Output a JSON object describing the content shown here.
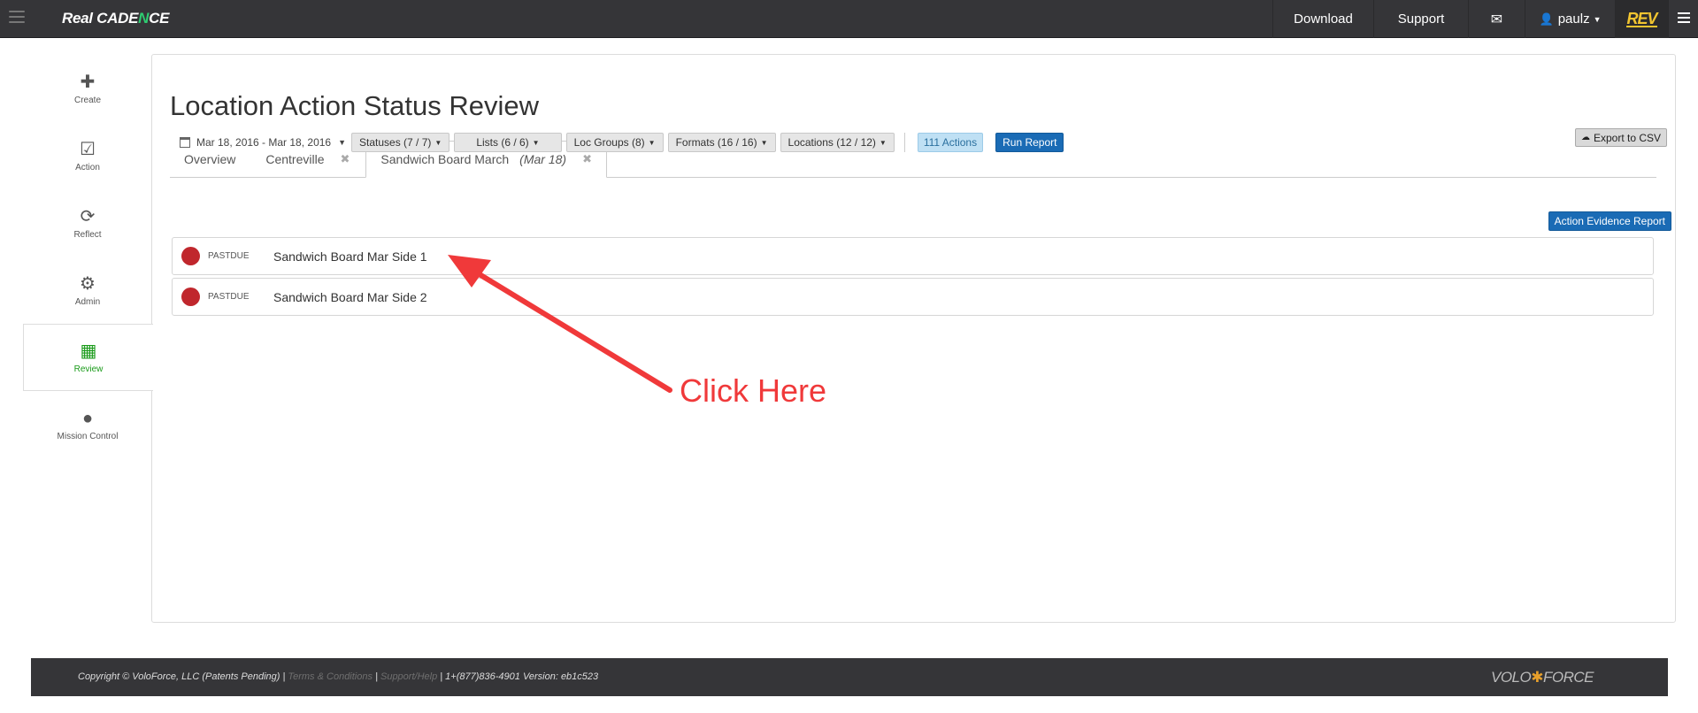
{
  "app": {
    "brand_part1": "Real CADE",
    "brand_accent": "N",
    "brand_part2": "CE"
  },
  "nav": {
    "download": "Download",
    "support": "Support",
    "mail_icon": "✉",
    "user_name": "paulz",
    "rev_logo": "REV"
  },
  "sidebar": {
    "items": [
      {
        "label": "Create",
        "icon": "✚"
      },
      {
        "label": "Action",
        "icon": "☑"
      },
      {
        "label": "Reflect",
        "icon": "⟳"
      },
      {
        "label": "Admin",
        "icon": "⚙"
      },
      {
        "label": "Review",
        "icon": "▦"
      },
      {
        "label": "Mission Control",
        "icon": "●"
      }
    ]
  },
  "page": {
    "title": "Location Action Status Review",
    "date_range": "Mar 18, 2016 - Mar 18, 2016",
    "filters": {
      "statuses": "Statuses (7 / 7)",
      "lists": "Lists (6 / 6)",
      "loc_groups": "Loc Groups (8)",
      "formats": "Formats (16 / 16)",
      "locations": "Locations (12 / 12)"
    },
    "actions_count": "111 Actions",
    "run_report": "Run Report",
    "export_csv": "Export to CSV",
    "action_evidence_report": "Action Evidence Report"
  },
  "tabs": [
    {
      "label": "Overview"
    },
    {
      "label": "Centreville"
    },
    {
      "label": "Sandwich Board March",
      "sub": "(Mar 18)"
    }
  ],
  "actions": [
    {
      "status": "PASTDUE",
      "name": "Sandwich Board Mar Side 1"
    },
    {
      "status": "PASTDUE",
      "name": "Sandwich Board Mar Side 2"
    }
  ],
  "annotation": {
    "label": "Click Here",
    "color": "#f0393a"
  },
  "footer": {
    "copyright": "Copyright © VoloForce, LLC (Patents Pending) |",
    "terms": "Terms & Conditions",
    "divider": "|",
    "support_help": "Support/Help",
    "contact": "| 1+(877)836-4901 Version: eb1c523",
    "logo_left": "VOLO",
    "logo_right": "FORCE"
  }
}
